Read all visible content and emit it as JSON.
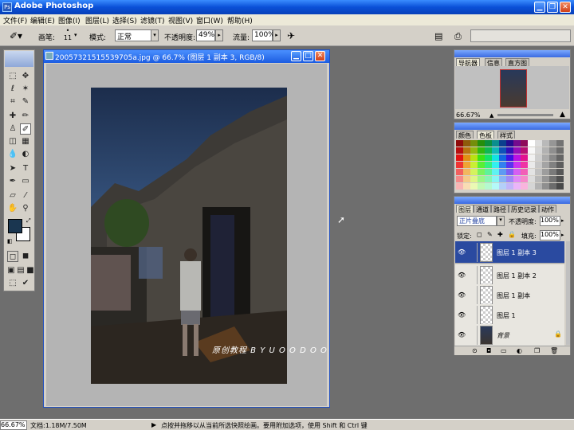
{
  "app": {
    "title": "Adobe Photoshop"
  },
  "menu": [
    "文件(F)",
    "编辑(E)",
    "图像(I)",
    "图层(L)",
    "选择(S)",
    "滤镜(T)",
    "视图(V)",
    "窗口(W)",
    "帮助(H)"
  ],
  "options": {
    "brush_label": "画笔:",
    "brush_size": "11",
    "mode_label": "模式:",
    "mode_value": "正常",
    "opacity_label": "不透明度:",
    "opacity_value": "49%",
    "flow_label": "流量:",
    "flow_value": "100%"
  },
  "document": {
    "title": "20057321515539705a.jpg @ 66.7% (图层 1 副本 3, RGB/8)",
    "watermark": "原创教程   B Y   U O O D O O"
  },
  "navigator": {
    "tabs": [
      "导航器",
      "信息",
      "直方图"
    ],
    "zoom": "66.67%"
  },
  "color_panel": {
    "tabs": [
      "颜色",
      "色板",
      "样式"
    ]
  },
  "layers_panel": {
    "tabs": [
      "图层",
      "通道",
      "路径",
      "历史记录",
      "动作"
    ],
    "blend_mode": "正片叠底",
    "opacity_label": "不透明度:",
    "opacity_value": "100%",
    "lock_label": "锁定:",
    "fill_label": "填充:",
    "fill_value": "100%",
    "layers": [
      {
        "name": "图层 1 副本 3",
        "selected": true
      },
      {
        "name": "图层 1 副本 2",
        "selected": false
      },
      {
        "name": "图层 1 副本",
        "selected": false
      },
      {
        "name": "图层 1",
        "selected": false
      },
      {
        "name": "背景",
        "selected": false
      }
    ]
  },
  "status": {
    "zoom": "66.67%",
    "doc": "文档:1.18M/7.50M",
    "hint": "点按并拖移以从当前所选快照绘画。要用附加选项，使用 Shift 和 Ctrl 键"
  },
  "colors": {
    "foreground": "#1a3650",
    "background": "#ffffff",
    "selection": "#2a4aa0"
  }
}
